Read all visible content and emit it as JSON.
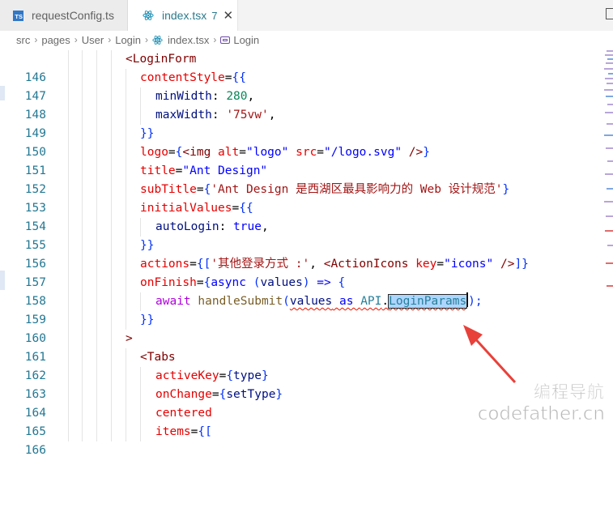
{
  "tabs": [
    {
      "label": "requestConfig.ts",
      "icon": "typescript-file-icon"
    },
    {
      "label": "index.tsx",
      "modified": "7",
      "icon": "react-file-icon",
      "close": "✕"
    }
  ],
  "breadcrumb": [
    "src",
    "pages",
    "User",
    "Login",
    "index.tsx",
    "Login"
  ],
  "editor": {
    "line_numbers": [
      "146",
      "147",
      "148",
      "149",
      "150",
      "151",
      "152",
      "153",
      "154",
      "155",
      "156",
      "157",
      "158",
      "159",
      "160",
      "161",
      "162",
      "163",
      "164",
      "165",
      "166"
    ],
    "lines": {
      "l146": {
        "open": "<",
        "tag": "LoginForm"
      },
      "l147": {
        "attr": "contentStyle",
        "eq": "=",
        "brace": "{{"
      },
      "l148": {
        "key": "minWidth",
        "colon": ": ",
        "num": "280",
        "comma": ","
      },
      "l149": {
        "key": "maxWidth",
        "colon": ": ",
        "str": "'75vw'",
        "comma": ","
      },
      "l150": {
        "brace": "}}"
      },
      "l151": {
        "attr": "logo",
        "eq": "=",
        "b1": "{",
        "lt": "<",
        "tag": "img",
        "a1": " alt",
        "e1": "=",
        "s1": "\"logo\"",
        "a2": " src",
        "e2": "=",
        "s2": "\"/logo.svg\"",
        "close": " />",
        "b2": "}"
      },
      "l152": {
        "attr": "title",
        "eq": "=",
        "str": "\"Ant Design\""
      },
      "l153": {
        "attr": "subTitle",
        "eq": "=",
        "b1": "{",
        "str": "'Ant Design 是西湖区最具影响力的 Web 设计规范'",
        "b2": "}"
      },
      "l154": {
        "attr": "initialValues",
        "eq": "=",
        "brace": "{{"
      },
      "l155": {
        "key": "autoLogin",
        "colon": ": ",
        "kw": "true",
        "comma": ","
      },
      "l156": {
        "brace": "}}"
      },
      "l157": {
        "attr": "actions",
        "eq": "=",
        "b1": "{[",
        "str": "'其他登录方式 :'",
        "comma": ", ",
        "lt": "<",
        "tag": "ActionIcons",
        "a1": " key",
        "e1": "=",
        "s1": "\"icons\"",
        "close": " />",
        "b2": "]}"
      },
      "l158": {
        "attr": "onFinish",
        "eq": "=",
        "b1": "{",
        "kw": "async",
        "p1": " (",
        "param": "values",
        "p2": ") ",
        "arrow": "=>",
        "b2": " {"
      },
      "l159": {
        "kw": "await",
        "fn": " handleSubmit",
        "p1": "(",
        "arg": "values",
        "as": " as ",
        "ns": "API",
        "dot": ".",
        "type": "LoginParams",
        "p2": ");"
      },
      "l160": {
        "brace": "}}"
      },
      "l161": {
        "gt": ">"
      },
      "l162": {
        "open": "<",
        "tag": "Tabs"
      },
      "l163": {
        "attr": "activeKey",
        "eq": "=",
        "b1": "{",
        "val": "type",
        "b2": "}"
      },
      "l164": {
        "attr": "onChange",
        "eq": "=",
        "b1": "{",
        "val": "setType",
        "b2": "}"
      },
      "l165": {
        "attr": "centered"
      },
      "l166": {
        "attr": "items",
        "eq": "=",
        "brace": "{["
      }
    }
  },
  "watermark": {
    "line1": "编程导航",
    "line2": "codefather.cn"
  },
  "colors": {
    "tag": "#800000",
    "attr": "#e50000",
    "string": "#a31515",
    "number": "#098658",
    "keyword": "#0000ff",
    "selection": "#add6ff",
    "arrow": "#e8413a"
  }
}
